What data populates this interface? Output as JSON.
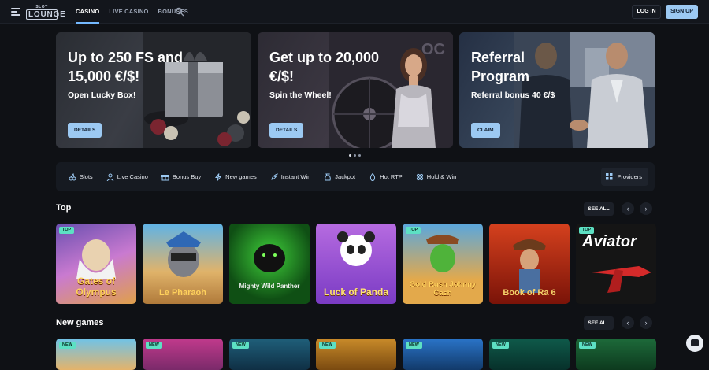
{
  "header": {
    "logo_small": "SLOT",
    "logo_main": "LOUNGE",
    "nav": [
      "CASINO",
      "LIVE CASINO",
      "BONUSES"
    ],
    "login": "LOG IN",
    "signup": "SIGN UP"
  },
  "banners": [
    {
      "title": "Up to 250 FS and 15,000 €/$!",
      "subtitle": "Open Lucky Box!",
      "button": "DETAILS"
    },
    {
      "title": "Get up to 20,000 €/$!",
      "subtitle": "Spin the Wheel!",
      "button": "DETAILS"
    },
    {
      "title": "Referral Program",
      "subtitle": "Referral bonus 40 €/$",
      "button": "CLAIM"
    }
  ],
  "categories": [
    "Slots",
    "Live Casino",
    "Bonus Buy",
    "New games",
    "Instant Win",
    "Jackpot",
    "Hot RTP",
    "Hold & Win"
  ],
  "providers": "Providers",
  "sections": {
    "top": {
      "title": "Top",
      "see_all": "SEE ALL"
    },
    "new_games": {
      "title": "New games",
      "see_all": "SEE ALL"
    }
  },
  "top_games": [
    {
      "name": "Gates of Olympus",
      "badge": "TOP"
    },
    {
      "name": "Le Pharaoh",
      "badge": ""
    },
    {
      "name": "Mighty Wild Panther",
      "badge": ""
    },
    {
      "name": "Luck of Panda",
      "badge": ""
    },
    {
      "name": "Gold Rush Johnny Cash",
      "badge": "TOP"
    },
    {
      "name": "Book of Ra 6",
      "badge": ""
    },
    {
      "name": "Aviator",
      "badge": "TOP"
    }
  ],
  "new_badge": "NEW"
}
